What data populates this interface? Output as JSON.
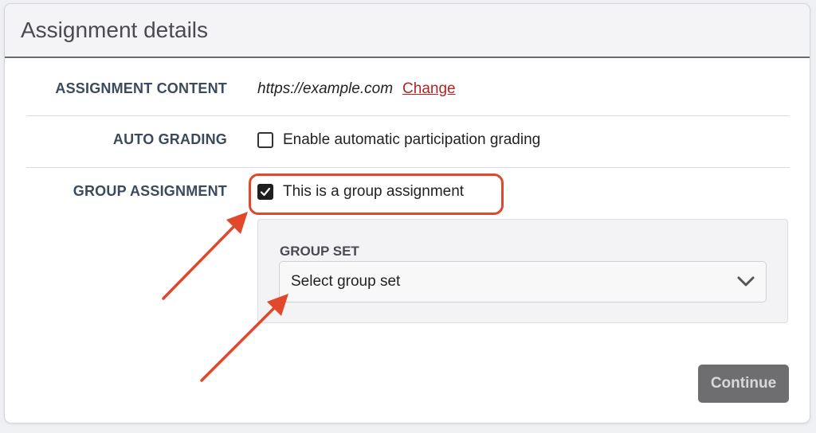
{
  "header": {
    "title": "Assignment details"
  },
  "rows": {
    "content": {
      "label": "ASSIGNMENT CONTENT",
      "url": "https://example.com",
      "change_link": "Change"
    },
    "auto_grading": {
      "label": "AUTO GRADING",
      "checkbox_label": "Enable automatic participation grading",
      "checked": false
    },
    "group_assignment": {
      "label": "GROUP ASSIGNMENT",
      "checkbox_label": "This is a group assignment",
      "checked": true
    }
  },
  "group_set": {
    "label": "GROUP SET",
    "selected": "Select group set"
  },
  "actions": {
    "continue_label": "Continue"
  },
  "colors": {
    "annotation": "#e0472b",
    "link": "#b32424",
    "label": "#3c4a5e",
    "button_disabled": "#6e6e70"
  },
  "icons": {
    "checkmark": "checkmark-icon",
    "dropdown": "chevron-down-icon",
    "annotation_arrow": "arrow-icon"
  }
}
